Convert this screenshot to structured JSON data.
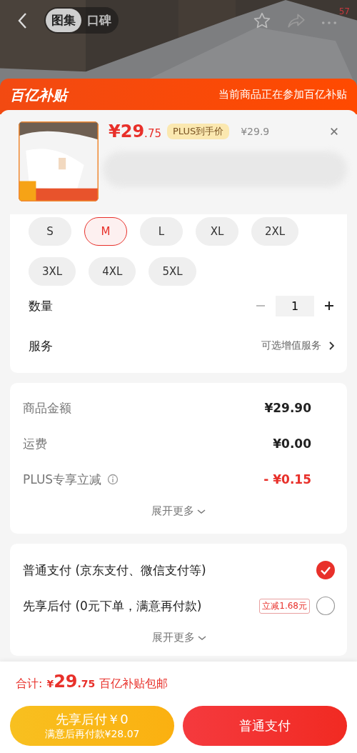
{
  "nav": {
    "tabs": [
      {
        "label": "图集",
        "selected": true
      },
      {
        "label": "口碑",
        "selected": false
      }
    ],
    "badge": "57"
  },
  "banner": {
    "logo": "百亿补贴",
    "note": "当前商品正在参加百亿补贴"
  },
  "product": {
    "price_main": "¥29",
    "price_decimal": ".75",
    "price_tag": "PLUS到手价",
    "original_price": "¥29.9"
  },
  "sizes": [
    {
      "label": "S",
      "selected": false
    },
    {
      "label": "M",
      "selected": true
    },
    {
      "label": "L",
      "selected": false
    },
    {
      "label": "XL",
      "selected": false
    },
    {
      "label": "2XL",
      "selected": false
    },
    {
      "label": "3XL",
      "selected": false
    },
    {
      "label": "4XL",
      "selected": false
    },
    {
      "label": "5XL",
      "selected": false
    }
  ],
  "quantity": {
    "label": "数量",
    "value": "1"
  },
  "service": {
    "label": "服务",
    "value": "可选增值服务"
  },
  "summary": [
    {
      "label": "商品金额",
      "value": "¥29.90",
      "kind": "plain"
    },
    {
      "label": "运费",
      "value": "¥0.00",
      "kind": "plain"
    },
    {
      "label": "PLUS专享立减",
      "value": "- ¥0.15",
      "kind": "discount"
    }
  ],
  "summary_more": "展开更多",
  "payments": [
    {
      "label": "普通支付 (京东支付、微信支付等)",
      "selected": true
    },
    {
      "label": "先享后付 (0元下单，满意再付款)",
      "tag": "立减1.68元",
      "selected": false
    }
  ],
  "payments_more": "展开更多",
  "total": {
    "label": "合计:",
    "currency": "¥",
    "main": "29",
    "decimal": ".75",
    "note": "百亿补贴包邮"
  },
  "buttons": [
    {
      "kind": "later",
      "line1": "先享后付￥0",
      "line2": "满意后再付款¥28.07"
    },
    {
      "kind": "normal",
      "line1": "普通支付"
    }
  ]
}
